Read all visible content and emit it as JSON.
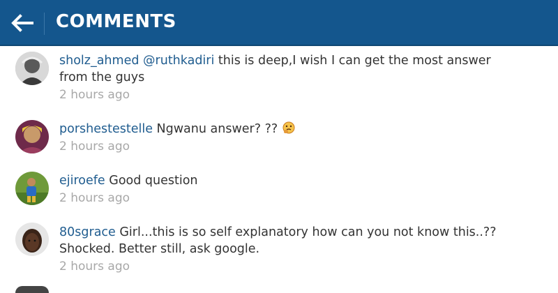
{
  "header": {
    "title": "COMMENTS",
    "back_icon": "arrow-left-icon",
    "background": "#14568d"
  },
  "comments": [
    {
      "username": "sholz_ahmed",
      "mention": "@ruthkadiri",
      "text": " this is deep,I wish I can get the most answer from the guys",
      "time": "2 hours ago",
      "avatar": "avatar-photo"
    },
    {
      "username": "porshestestelle",
      "text": " Ngwanu answer? ??",
      "emoji": "thinking-face-emoji",
      "time": "2 hours ago",
      "avatar": "avatar-photo"
    },
    {
      "username": "ejiroefe",
      "text": " Good question",
      "time": "2 hours ago",
      "avatar": "avatar-photo"
    },
    {
      "username": "80sgrace",
      "text": " Girl...this is so self explanatory how can you not know this..?? Shocked. Better still, ask google.",
      "time": "2 hours ago",
      "avatar": "avatar-photo"
    }
  ],
  "colors": {
    "username": "#1f5c8f",
    "comment_text": "#333333",
    "timestamp": "#a8a8a8"
  }
}
